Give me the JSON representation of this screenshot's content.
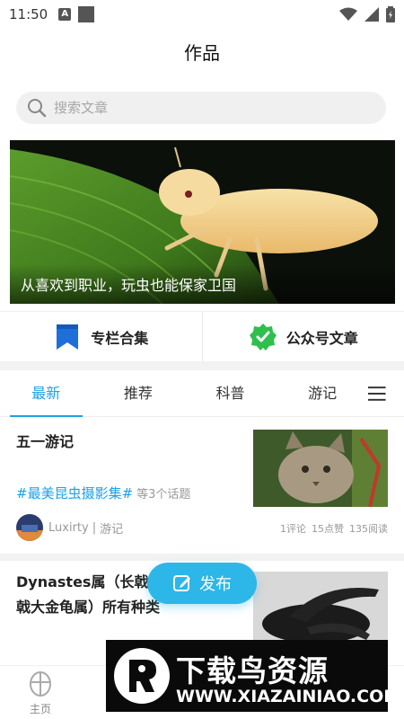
{
  "status_bar": {
    "time": "11:50",
    "notification_letter": "A"
  },
  "header": {
    "title": "作品"
  },
  "search": {
    "placeholder": "搜索文章"
  },
  "banner": {
    "caption": "从喜欢到职业，玩虫也能保家卫国"
  },
  "quick_links": [
    {
      "label": "专栏合集",
      "icon": "bookmark-icon"
    },
    {
      "label": "公众号文章",
      "icon": "verified-badge-icon"
    }
  ],
  "tabs": [
    {
      "label": "最新",
      "active": true
    },
    {
      "label": "推荐",
      "active": false
    },
    {
      "label": "科普",
      "active": false
    },
    {
      "label": "游记",
      "active": false
    }
  ],
  "articles": [
    {
      "title": "五一游记",
      "tag": "#最美昆虫摄影集#",
      "tag_more": "等3个话题",
      "author": "Luxirty",
      "category": "游记",
      "comments": "1评论",
      "likes": "15点赞",
      "reads": "135阅读"
    },
    {
      "title": "Dynastes属（长戟大兜虫属，长戟大金龟属）所有种类"
    }
  ],
  "fab": {
    "label": "发布"
  },
  "bottom_nav": {
    "home_label": "主页"
  },
  "watermark": {
    "title": "下载鸟资源",
    "url": "WWW.XIAZAINIAO.COM"
  },
  "colors": {
    "accent": "#1da1e6",
    "fab": "#2db6e8",
    "badge_green": "#2fbf4d"
  }
}
